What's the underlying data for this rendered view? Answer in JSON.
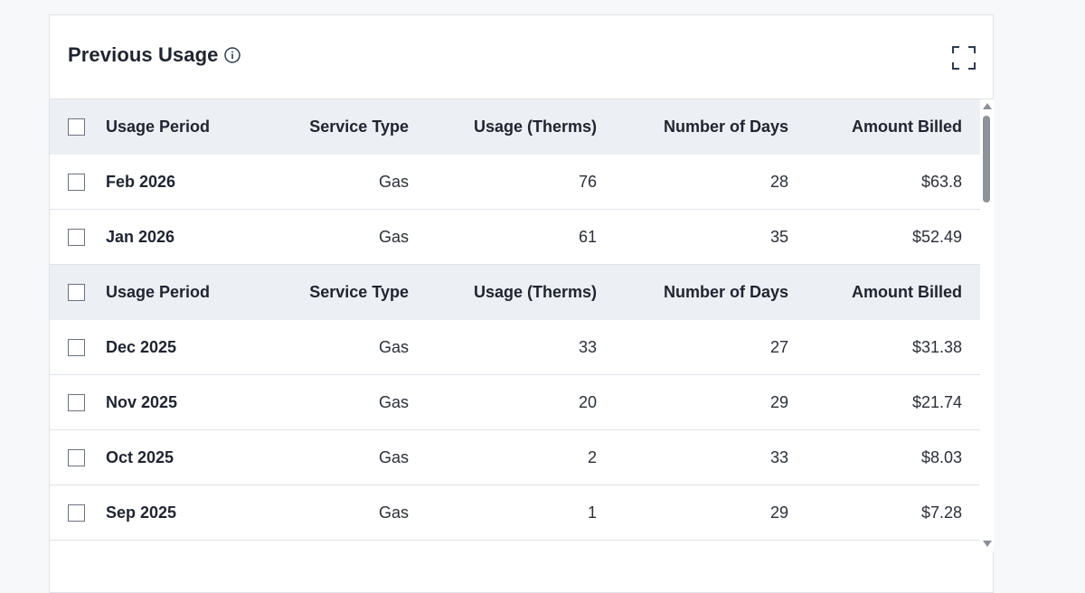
{
  "card": {
    "title": "Previous Usage",
    "info_icon": "info-icon",
    "expand_icon": "expand-icon"
  },
  "columns": {
    "period": "Usage Period",
    "service": "Service Type",
    "usage": "Usage (Therms)",
    "days": "Number of Days",
    "amount": "Amount Billed"
  },
  "groups": [
    {
      "rows": [
        {
          "period": "Feb 2026",
          "service": "Gas",
          "usage": "76",
          "days": "28",
          "amount": "$63.8"
        },
        {
          "period": "Jan 2026",
          "service": "Gas",
          "usage": "61",
          "days": "35",
          "amount": "$52.49"
        }
      ]
    },
    {
      "rows": [
        {
          "period": "Dec 2025",
          "service": "Gas",
          "usage": "33",
          "days": "27",
          "amount": "$31.38"
        },
        {
          "period": "Nov 2025",
          "service": "Gas",
          "usage": "20",
          "days": "29",
          "amount": "$21.74"
        },
        {
          "period": "Oct 2025",
          "service": "Gas",
          "usage": "2",
          "days": "33",
          "amount": "$8.03"
        },
        {
          "period": "Sep 2025",
          "service": "Gas",
          "usage": "1",
          "days": "29",
          "amount": "$7.28"
        }
      ]
    }
  ],
  "colors": {
    "header_bg": "#eceff3",
    "border": "#dfe2e7",
    "text": "#1f2430"
  }
}
